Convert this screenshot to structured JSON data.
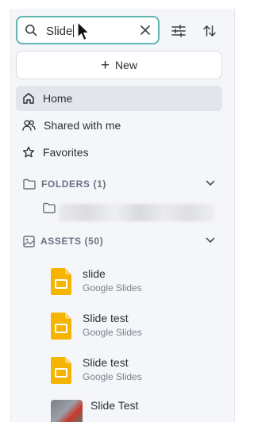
{
  "search": {
    "value": "Slide"
  },
  "toolbar": {
    "filter_icon": "sliders-icon",
    "sort_icon": "sort-arrows-icon"
  },
  "new_button": {
    "label": "New"
  },
  "nav": [
    {
      "label": "Home",
      "icon": "home-icon",
      "active": true
    },
    {
      "label": "Shared with me",
      "icon": "users-icon",
      "active": false
    },
    {
      "label": "Favorites",
      "icon": "star-icon",
      "active": false
    }
  ],
  "folders": {
    "label": "FOLDERS (1)"
  },
  "assets": {
    "label": "ASSETS (50)",
    "items": [
      {
        "name": "slide",
        "type": "Google Slides"
      },
      {
        "name": "Slide test",
        "type": "Google Slides"
      },
      {
        "name": "Slide test",
        "type": "Google Slides"
      },
      {
        "name": "Slide Test",
        "type": ""
      }
    ]
  },
  "colors": {
    "focus_border": "#5fb7b0",
    "active_bg": "#e2e5ec",
    "panel_bg": "#f5f6fa",
    "slides_yellow": "#f4b400"
  }
}
